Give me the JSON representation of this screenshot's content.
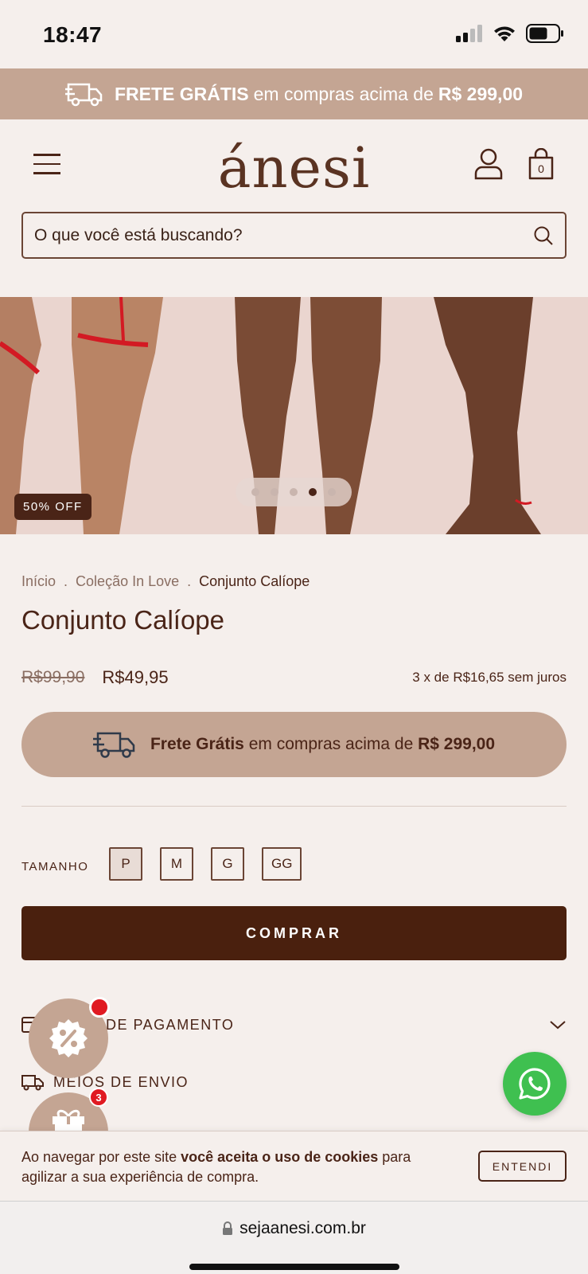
{
  "status_bar": {
    "time": "18:47"
  },
  "promo": {
    "bold": "FRETE GRÁTIS",
    "text": "em compras acima de",
    "amount": "R$ 299,00"
  },
  "header": {
    "logo": "ánesi",
    "bag_count": "0"
  },
  "search": {
    "placeholder": "O que você está buscando?"
  },
  "hero": {
    "badge": "50% OFF",
    "dots": 5,
    "active_dot": 4
  },
  "breadcrumb": {
    "items": [
      "Início",
      "Coleção In Love",
      "Conjunto Calíope"
    ],
    "separator": "."
  },
  "product": {
    "title": "Conjunto Calíope",
    "price_old": "R$99,90",
    "price_new": "R$49,95",
    "installments": "3 x de R$16,65 sem juros"
  },
  "shipping_banner": {
    "bold": "Frete Grátis",
    "text": "em compras acima de",
    "amount": "R$ 299,00"
  },
  "size": {
    "label": "TAMANHO",
    "options": [
      "P",
      "M",
      "G",
      "GG"
    ],
    "selected": "P"
  },
  "buy_button": "COMPRAR",
  "accordion": {
    "payment": "DE PAGAMENTO",
    "shipping": "MEIOS DE ENVIO"
  },
  "gift_badge": "3",
  "cookie": {
    "text_prefix": "Ao navegar por este site",
    "text_bold": "você aceita o uso de cookies",
    "text_suffix": "para agilizar a sua experiência de compra.",
    "button": "ENTENDI"
  },
  "browser": {
    "url": "sejaanesi.com.br"
  },
  "colors": {
    "brand_dark": "#4a200e",
    "brand_beige": "#c4a593",
    "background": "#f5efec",
    "whatsapp": "#3fc050",
    "notification": "#e01a22"
  }
}
